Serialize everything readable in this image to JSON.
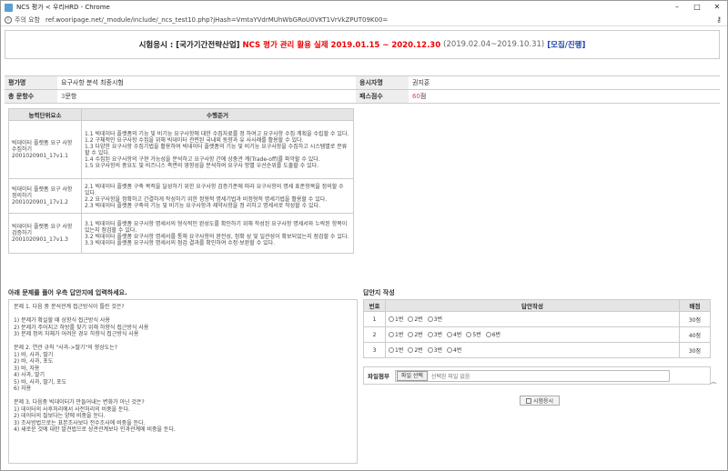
{
  "browser": {
    "title": "NCS 평가 < 우리HRD - Chrome",
    "warning": "주의 요함",
    "url": "ref.wooripage.net/_module/include/_ncs_test10.php?jHash=VmtaYVdrMUhWbGRoU0VKT1VrVkZPUT09K00="
  },
  "header": {
    "part1": "시험응시 : [국가기간전략산업]",
    "part2": "NCS 평가 관리 활용 실제 2019.01.15 ~ 2020.12.30",
    "part3": "(2019.02.04~2019.10.31)",
    "part4": "[모집/진행]"
  },
  "info": {
    "eval_name_label": "평가명",
    "eval_name": "요구사항 분석 최종시험",
    "applicant_label": "응시자명",
    "applicant": "권지훈",
    "total_label": "총 문항수",
    "total_num": "3",
    "total_unit": "문항",
    "pass_label": "패스점수",
    "pass_num": "60",
    "pass_unit": "점"
  },
  "competency": {
    "headers": [
      "능력단위요소",
      "수행준거"
    ],
    "rows": [
      {
        "unit": "빅데이터 플랫폼 요구 사항 수집하기\n2001020901_17v1.1",
        "criteria": "1.1 빅데이터 플랫폼의 기능 및 비기능 요구사항에 대한 수집자료를 정 하여고 요구사항 수집 계획을 수립할 수 있다.\n1.2 구체적인 요구사항 수집을 위해 빅데이터 관련된 국내외 동향과 유 사사례를 활용할 수 있다.\n1.3 다양한 요구사항 수집기법을 활용하여 빅데이터 플랫폼의 기능 및 비기능 요구사항을 수집하고 시스템별로 분류할 수 있다.\n1.4 수집된 요구사항의 구현 가능성을 분석하고 요구사항 간에 상충관 계(Trade-off)를 파악할 수 있다.\n1.5 요구사항의 중요도 및 비즈니스 측면의 영향성을 분석하여 요구사 항별 우선순위를 도출할 수 있다."
      },
      {
        "unit": "빅데이터 플랫폼 요구 사항 정의하기\n2001020901_17v1.2",
        "criteria": "2.1 빅데이터 플랫폼 구축 목적을 달성하기 위한 요구사항 검증기준에 따라 요구사항의 명세 표준항목을 정의할 수 있다.\n2.2 요구사항을 정확하고 간결하게 작성하기 위한 정형적 명세기법과 비정형적 명세기법을 활용할 수 있다.\n2.3 빅데이터 플랫폼 구축의 기능 및 비기능 요구사항과 제약사항을 정 리하고 명세서로 작성할 수 있다."
      },
      {
        "unit": "빅데이터 플랫폼 요구 사항 검증하기\n2001020901_17v1.3",
        "criteria": "3.1 빅데이터 플랫폼 요구사항 명세서의 형식적인 완성도를 확인하기 위해 작성된 요구사항 명세서와 누락된 항목이 있는지 점검할 수 있다.\n3.2 빅데이터 플랫폼 요구사항 명세서를 통해 요구사항의 완전성, 정확 성 및 일관성이 확보되었는지 점검할 수 있다.\n3.3 빅데이터 플랫폼 요구사항 명세서의 점검 결과를 확인하여 수정·보완할 수 있다."
      }
    ]
  },
  "questions": {
    "title": "아래 문제를 풀어 우측 답안지에 입력하세요.",
    "lines": [
      "문제 1. 다음 중 분석관계 접근방식이 틀린 것은?",
      "",
      "1) 문제가 확실할 때 상향식 접근방식 사용",
      "2) 문제가 주어지고 하방를 찾기 위해 하향식 접근방식 사용",
      "3) 문제 정의 자체가 어려운 경우 하향식 접근방식 사용",
      "",
      "문제 2. 연관 규칙 \"사과->딸기\"의 향상도는?",
      "1) 바, 사과, 딸기",
      "2) 바, 사과, 포도",
      "3) 바, 자용",
      "4) 사과, 딸기",
      "5) 바, 사과, 딸기, 포도",
      "6) 자용",
      "",
      "문제 3. 다음중 빅데이터가 만들어내는 변화가 아닌 것은?",
      "1) 데이터의 사후처리에서 사전처리의 비중을 둔다.",
      "2) 데이터의 질보다는 양에 비중을 둔다.",
      "3) 조사방법으로는 표본조사보다 전수조사에 비중을 둔다.",
      "4) 새로운 것에 대한 발견법으로 상관관계보다 인과관계에 비중을 둔다."
    ]
  },
  "answers": {
    "title": "답안지 작성",
    "headers": [
      "번호",
      "답안작성",
      "배점"
    ],
    "rows": [
      {
        "num": "1",
        "options": [
          "1번",
          "2번",
          "3번"
        ],
        "points": "30점"
      },
      {
        "num": "2",
        "options": [
          "1번",
          "2번",
          "3번",
          "4번",
          "5번",
          "6번"
        ],
        "points": "40점"
      },
      {
        "num": "3",
        "options": [
          "1번",
          "2번",
          "3번",
          "4번"
        ],
        "points": "30점"
      }
    ],
    "file_label": "파일첨부",
    "file_button": "파일 선택",
    "file_status": "선택된 파일 없음",
    "submit": "시험응시"
  }
}
